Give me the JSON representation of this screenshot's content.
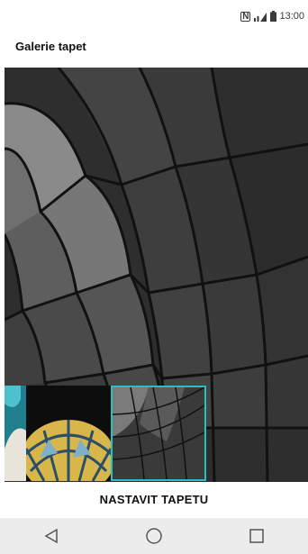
{
  "status_bar": {
    "time": "13:00",
    "nfc_label": "N"
  },
  "app": {
    "title": "Galerie tapet"
  },
  "wallpapers": [
    {
      "name": "teal-abstract"
    },
    {
      "name": "yellow-dome"
    },
    {
      "name": "grey-grid",
      "selected": true
    }
  ],
  "action": {
    "set_label": "NASTAVIT TAPETU"
  },
  "navigation": {
    "back_icon": "back-triangle-icon",
    "home_icon": "home-circle-icon",
    "recents_icon": "recents-square-icon"
  },
  "colors": {
    "accent": "#26c1c3",
    "nav_bar": "#ececec"
  }
}
